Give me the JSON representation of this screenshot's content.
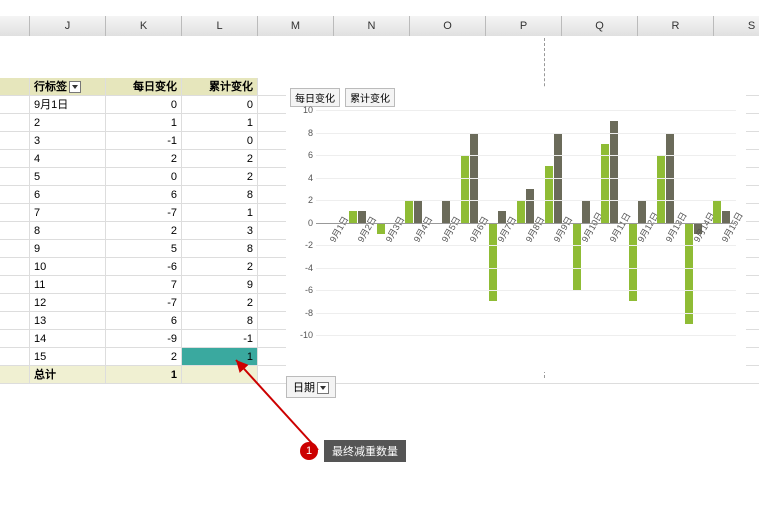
{
  "columns": [
    "",
    "J",
    "K",
    "L",
    "M",
    "N",
    "O",
    "P",
    "Q",
    "R",
    "S"
  ],
  "table": {
    "headers": {
      "rowLabel": "行标签",
      "daily": "每日变化",
      "cumulative": "累计变化"
    },
    "firstDate": "9月1日",
    "rows": [
      {
        "lbl": "9月1日",
        "d": 0,
        "c": 0
      },
      {
        "lbl": "2",
        "d": 1,
        "c": 1
      },
      {
        "lbl": "3",
        "d": -1,
        "c": 0
      },
      {
        "lbl": "4",
        "d": 2,
        "c": 2
      },
      {
        "lbl": "5",
        "d": 0,
        "c": 2
      },
      {
        "lbl": "6",
        "d": 6,
        "c": 8
      },
      {
        "lbl": "7",
        "d": -7,
        "c": 1
      },
      {
        "lbl": "8",
        "d": 2,
        "c": 3
      },
      {
        "lbl": "9",
        "d": 5,
        "c": 8
      },
      {
        "lbl": "10",
        "d": -6,
        "c": 2
      },
      {
        "lbl": "11",
        "d": 7,
        "c": 9
      },
      {
        "lbl": "12",
        "d": -7,
        "c": 2
      },
      {
        "lbl": "13",
        "d": 6,
        "c": 8
      },
      {
        "lbl": "14",
        "d": -9,
        "c": -1
      },
      {
        "lbl": "15",
        "d": 2,
        "c": 1
      }
    ],
    "total": {
      "label": "总计",
      "d": 1,
      "c": ""
    }
  },
  "chart_data": {
    "type": "bar",
    "title": "",
    "xlabel": "",
    "ylabel": "",
    "ylim": [
      -10,
      10
    ],
    "yticks": [
      -10,
      -8,
      -6,
      -4,
      -2,
      0,
      2,
      4,
      6,
      8,
      10
    ],
    "categories": [
      "9月1日",
      "9月2日",
      "9月3日",
      "9月4日",
      "9月5日",
      "9月6日",
      "9月7日",
      "9月8日",
      "9月9日",
      "9月10日",
      "9月11日",
      "9月12日",
      "9月13日",
      "9月14日",
      "9月15日"
    ],
    "series": [
      {
        "name": "每日变化",
        "color": "#8fbc35",
        "values": [
          0,
          1,
          -1,
          2,
          0,
          6,
          -7,
          2,
          5,
          -6,
          7,
          -7,
          6,
          -9,
          2
        ]
      },
      {
        "name": "累计变化",
        "color": "#6b6b5a",
        "values": [
          0,
          1,
          0,
          2,
          2,
          8,
          1,
          3,
          8,
          2,
          9,
          2,
          8,
          -1,
          1
        ]
      }
    ],
    "legend_position": "top-left"
  },
  "dateButton": "日期",
  "callout": {
    "num": "1",
    "text": "最终减重数量"
  },
  "selectedCell": {
    "row": 14,
    "col": "c",
    "value": 1
  }
}
